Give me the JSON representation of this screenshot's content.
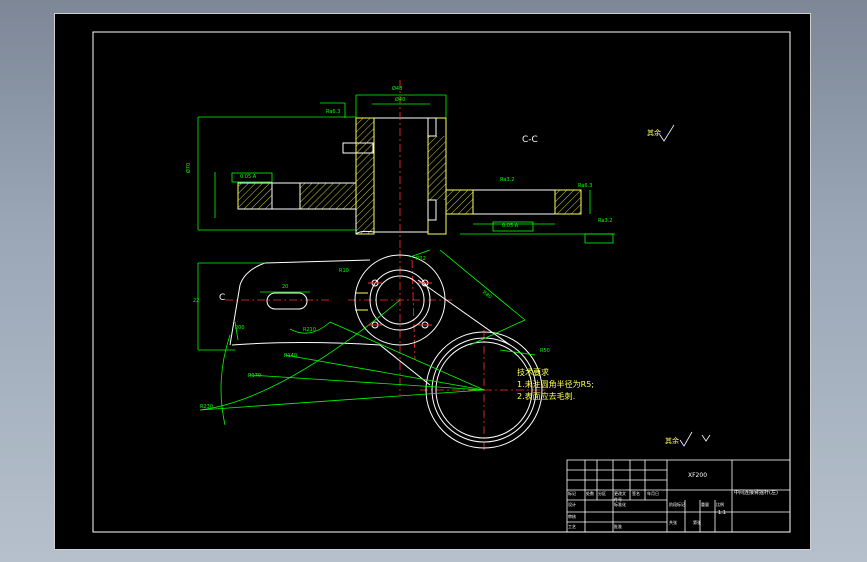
{
  "drawing": {
    "section_label": "C-C",
    "view_mark": "C",
    "tech_requirements": {
      "heading": "技术要求",
      "items": [
        "1.未注圆角半径为R5;",
        "2.表面应去毛刺."
      ]
    },
    "general_roughness": "其余",
    "roughness_top_right": "其余"
  },
  "dimensions": {
    "top_width": "Ø48",
    "top_bore": "Ø40",
    "left_height": "Ø70",
    "ra_left": "Ra6.3",
    "ra_right": "Ra3.2",
    "ra_right2": "Ra6.3",
    "ra_right3": "Ra3.2",
    "tol1": "0.05 A",
    "tol2": "0.05 A",
    "r_small": "R22",
    "r_mid": "R50",
    "r_big": "R80",
    "r140": "R140",
    "r170": "R170",
    "r230": "R230",
    "d20": "20",
    "slot_w": "22",
    "r210": "R210",
    "r10": "R10",
    "len_arm": "200"
  },
  "title_block": {
    "drawing_no": "XF200",
    "part_name": "中间连接臂摇杆(左)",
    "scale": "1:1",
    "labels": [
      "标记",
      "处数",
      "分区",
      "更改文件号",
      "签名",
      "年月日",
      "设计",
      "标准化",
      "审核",
      "工艺",
      "批准",
      "阶段标记",
      "重量",
      "比例",
      "共张",
      "第张"
    ]
  }
}
